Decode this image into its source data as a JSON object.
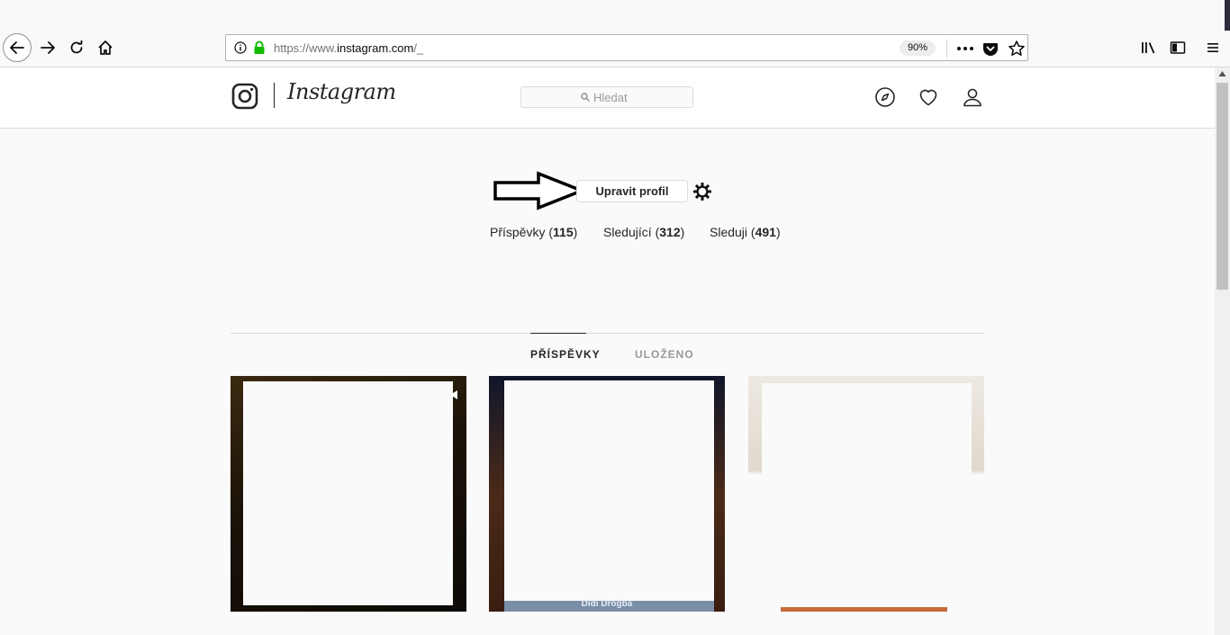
{
  "browser": {
    "url_prefix": "https://www.",
    "url_host": "instagram.com",
    "url_suffix": "/_",
    "zoom": "90%"
  },
  "header": {
    "wordmark": "Instagram",
    "search_placeholder": "Hledat"
  },
  "profile": {
    "edit_button": "Upravit profil",
    "stats": [
      {
        "label": "Příspěvky",
        "count": "115"
      },
      {
        "label": "Sledující",
        "count": "312"
      },
      {
        "label": "Sleduji",
        "count": "491"
      }
    ]
  },
  "tabs": [
    {
      "label": "PŘÍSPĚVKY",
      "active": true
    },
    {
      "label": "ULOŽENO",
      "active": false
    }
  ],
  "posts": [
    {
      "caption": ""
    },
    {
      "caption": "Didi Drogba"
    },
    {
      "caption": ""
    }
  ],
  "icons": {
    "back": "back-arrow-icon",
    "forward": "forward-arrow-icon",
    "reload": "reload-icon",
    "home": "home-icon",
    "info": "info-icon",
    "lock": "lock-icon",
    "more": "more-dots-icon",
    "pocket": "pocket-icon",
    "bookmark": "star-icon",
    "library": "library-icon",
    "sidebar": "sidebar-icon",
    "menu": "hamburger-menu-icon",
    "explore": "compass-icon",
    "activity": "heart-icon",
    "profile": "user-icon",
    "settings": "gear-icon"
  },
  "colors": {
    "ig_background": "#fafafa",
    "ig_border": "#dbdbdb",
    "ig_text": "#262626",
    "ig_muted": "#999999",
    "lock_green": "#12bc00"
  }
}
